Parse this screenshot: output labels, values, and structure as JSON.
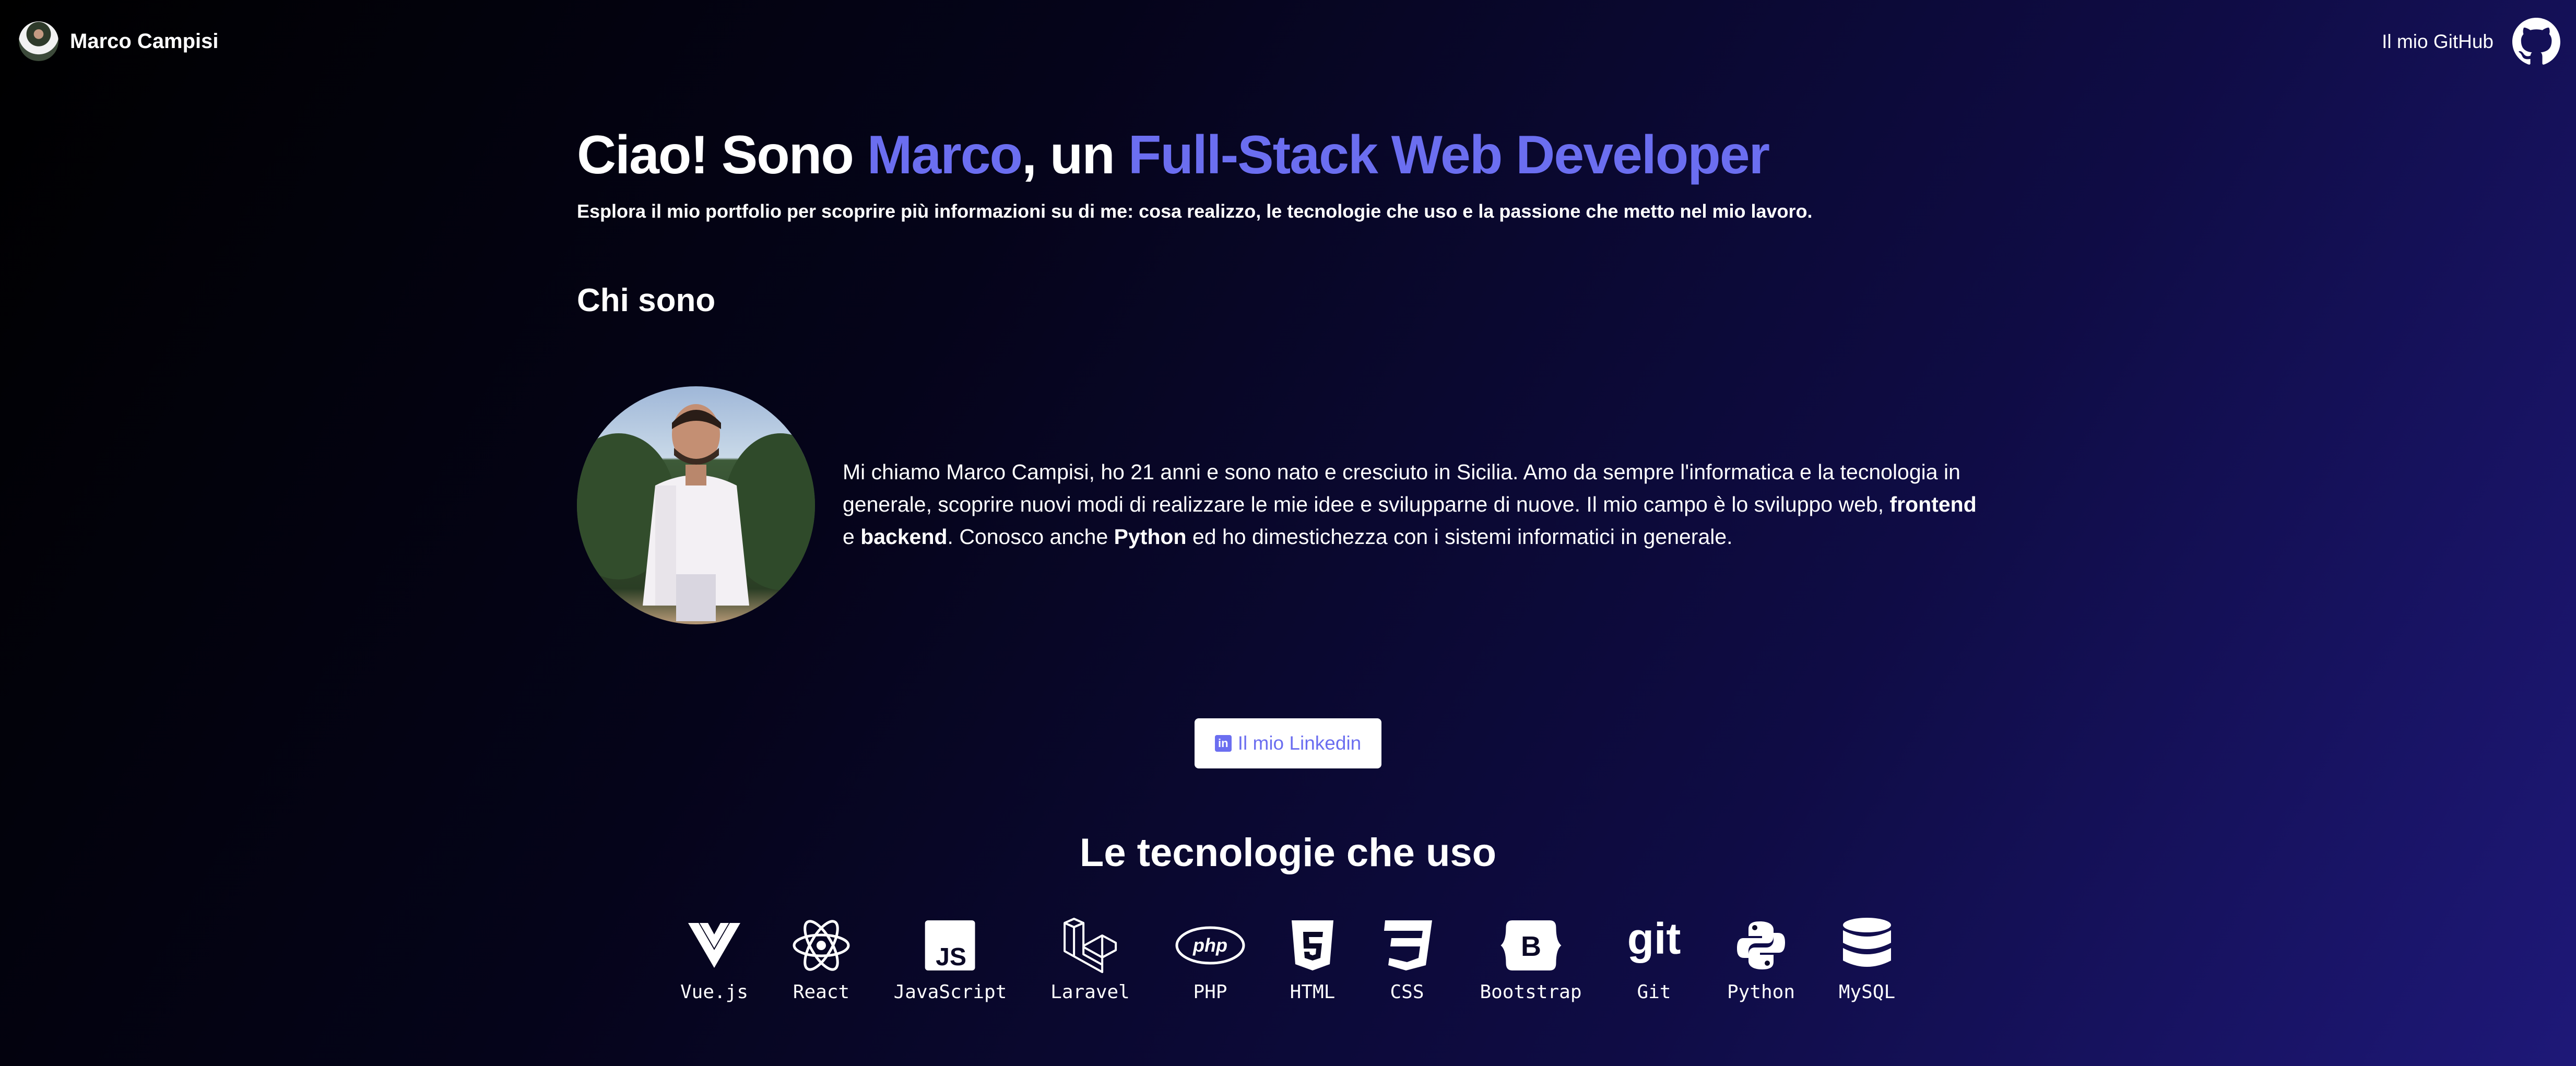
{
  "navbar": {
    "brand_name": "Marco Campisi",
    "github_label": "Il mio GitHub"
  },
  "hero": {
    "title_part1": "Ciao! Sono ",
    "title_name": "Marco",
    "title_part2": ", un ",
    "title_role": "Full-Stack Web Developer",
    "subtitle": "Esplora il mio portfolio per scoprire più informazioni su di me: cosa realizzo, le tecnologie che uso e la passione che metto nel mio lavoro."
  },
  "about": {
    "title": "Chi sono",
    "text_1": "Mi chiamo Marco Campisi, ho 21 anni e sono nato e cresciuto in Sicilia. Amo da sempre l'informatica e la tecnologia in generale, scoprire nuovi modi di realizzare le mie idee e svilupparne di nuove. Il mio campo è lo sviluppo web, ",
    "bold_1": "frontend",
    "text_2": " e ",
    "bold_2": "backend",
    "text_3": ". Conosco anche ",
    "bold_3": "Python",
    "text_4": " ed ho dimestichezza con i sistemi informatici in generale."
  },
  "linkedin": {
    "label": "Il mio Linkedin",
    "icon": "linkedin-icon"
  },
  "technologies": {
    "title": "Le tecnologie che uso",
    "items": [
      {
        "label": "Vue.js",
        "icon": "vue-icon"
      },
      {
        "label": "React",
        "icon": "react-icon"
      },
      {
        "label": "JavaScript",
        "icon": "javascript-icon"
      },
      {
        "label": "Laravel",
        "icon": "laravel-icon"
      },
      {
        "label": "PHP",
        "icon": "php-icon"
      },
      {
        "label": "HTML",
        "icon": "html5-icon"
      },
      {
        "label": "CSS",
        "icon": "css3-icon"
      },
      {
        "label": "Bootstrap",
        "icon": "bootstrap-icon"
      },
      {
        "label": "Git",
        "icon": "git-icon"
      },
      {
        "label": "Python",
        "icon": "python-icon"
      },
      {
        "label": "MySQL",
        "icon": "mysql-icon"
      }
    ]
  },
  "colors": {
    "accent": "#6b6ef0",
    "text": "#ffffff",
    "bg_start": "#000000",
    "bg_end": "#1e1878"
  }
}
